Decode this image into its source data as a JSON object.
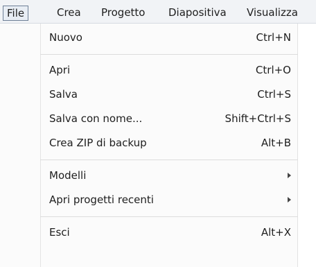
{
  "menubar": {
    "items": [
      {
        "label": "File"
      },
      {
        "label": "Crea"
      },
      {
        "label": "Progetto"
      },
      {
        "label": "Diapositiva"
      },
      {
        "label": "Visualizza"
      }
    ]
  },
  "file_menu": {
    "items": [
      {
        "label": "Nuovo",
        "shortcut": "Ctrl+N"
      },
      {
        "label": "Apri",
        "shortcut": "Ctrl+O"
      },
      {
        "label": "Salva",
        "shortcut": "Ctrl+S"
      },
      {
        "label": "Salva con nome...",
        "shortcut": "Shift+Ctrl+S"
      },
      {
        "label": "Crea ZIP di backup",
        "shortcut": "Alt+B"
      },
      {
        "label": "Modelli",
        "submenu": true
      },
      {
        "label": "Apri progetti recenti",
        "submenu": true
      },
      {
        "label": "Esci",
        "shortcut": "Alt+X"
      }
    ]
  },
  "colors": {
    "menubar_bg": "#f1f3f6",
    "active_border": "#6e7f96",
    "menu_bg": "#fbfbfb",
    "separator": "#dcdcdc"
  },
  "icons": {
    "submenu": "chevron-right-icon"
  }
}
